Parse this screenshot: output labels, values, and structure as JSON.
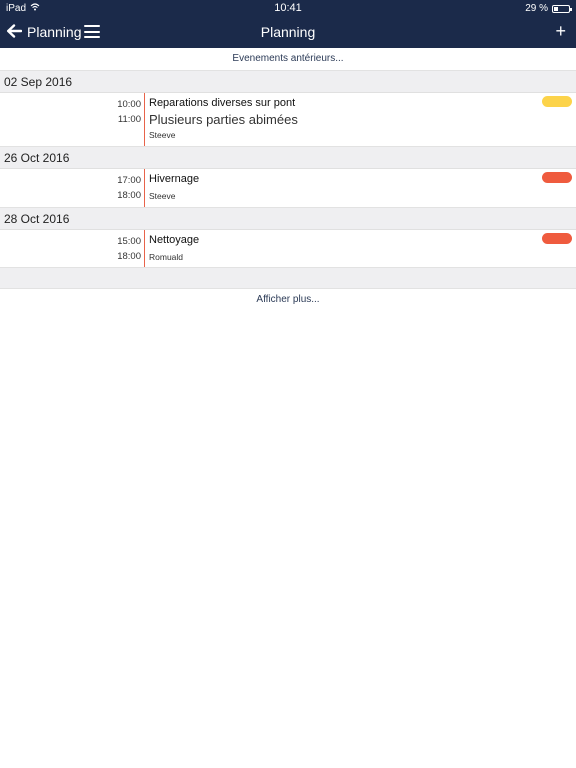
{
  "status_bar": {
    "device": "iPad",
    "time": "10:41",
    "battery": "29 %",
    "battery_level": 0.29
  },
  "nav": {
    "back_label": "Planning",
    "title": "Planning",
    "add_label": "+"
  },
  "earlier_label": "Evenements antérieurs...",
  "days": [
    {
      "date": "02 Sep 2016",
      "events": [
        {
          "start": "10:00",
          "end": "11:00",
          "title": "Reparations diverses sur pont",
          "subtitle": "Plusieurs parties abimées",
          "person": "Steeve",
          "color": "#fcd34a"
        }
      ]
    },
    {
      "date": "26 Oct 2016",
      "events": [
        {
          "start": "17:00",
          "end": "18:00",
          "title": "Hivernage",
          "person": "Steeve",
          "color": "#ef5b3e"
        }
      ]
    },
    {
      "date": "28 Oct 2016",
      "events": [
        {
          "start": "15:00",
          "end": "18:00",
          "title": "Nettoyage",
          "person": "Romuald",
          "color": "#ef5b3e"
        }
      ]
    }
  ],
  "more_label": "Afficher plus...",
  "colors": {
    "nav_bg": "#1b2a4a",
    "accent_line": "#e8634a"
  }
}
